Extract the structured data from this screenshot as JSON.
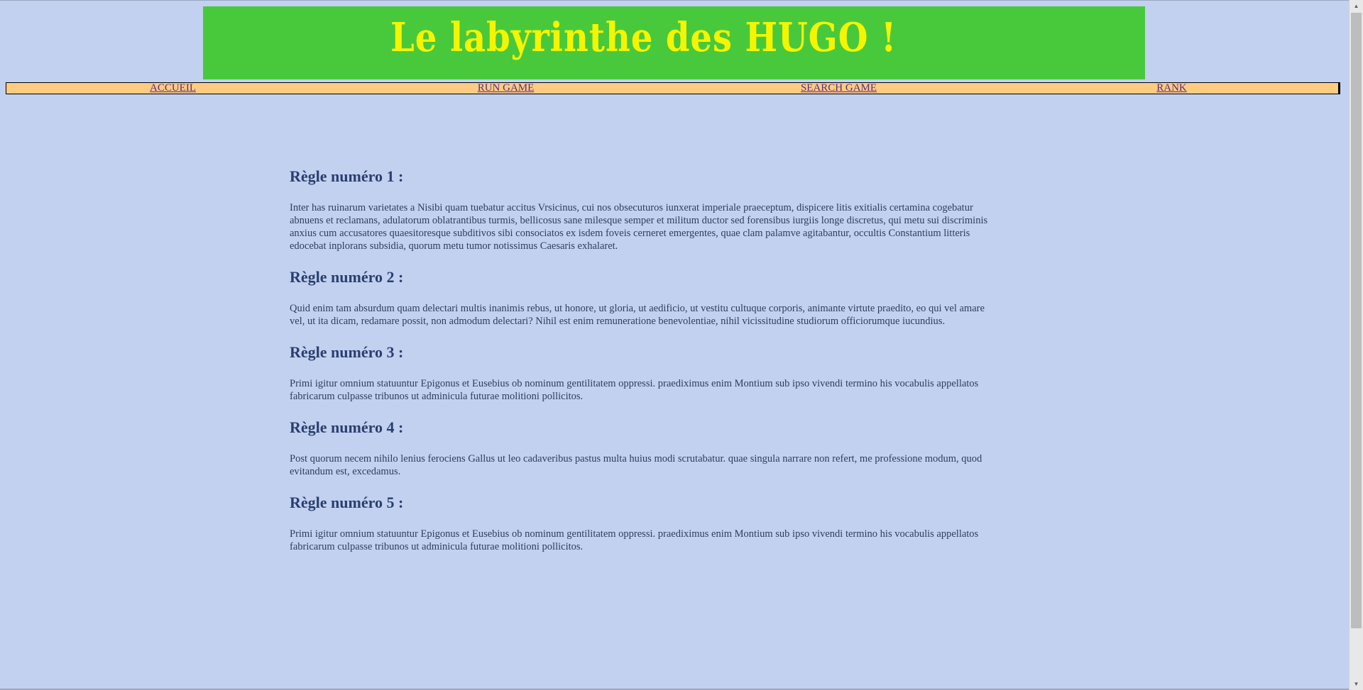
{
  "header": {
    "title": "Le labyrinthe des HUGO !"
  },
  "nav": {
    "items": [
      {
        "label": "ACCUEIL"
      },
      {
        "label": "RUN GAME"
      },
      {
        "label": "SEARCH GAME"
      },
      {
        "label": "RANK"
      }
    ]
  },
  "rules": [
    {
      "title": "Règle numéro 1 :",
      "text": "Inter has ruinarum varietates a Nisibi quam tuebatur accitus Vrsicinus, cui nos obsecuturos iunxerat imperiale praeceptum, dispicere litis exitialis certamina cogebatur abnuens et reclamans, adulatorum oblatrantibus turmis, bellicosus sane milesque semper et militum ductor sed forensibus iurgiis longe discretus, qui metu sui discriminis anxius cum accusatores quaesitoresque subditivos sibi consociatos ex isdem foveis cerneret emergentes, quae clam palamve agitabantur, occultis Constantium litteris edocebat inplorans subsidia, quorum metu tumor notissimus Caesaris exhalaret."
    },
    {
      "title": "Règle numéro 2 :",
      "text": "Quid enim tam absurdum quam delectari multis inanimis rebus, ut honore, ut gloria, ut aedificio, ut vestitu cultuque corporis, animante virtute praedito, eo qui vel amare vel, ut ita dicam, redamare possit, non admodum delectari? Nihil est enim remuneratione benevolentiae, nihil vicissitudine studiorum officiorumque iucundius."
    },
    {
      "title": "Règle numéro 3 :",
      "text": "Primi igitur omnium statuuntur Epigonus et Eusebius ob nominum gentilitatem oppressi. praediximus enim Montium sub ipso vivendi termino his vocabulis appellatos fabricarum culpasse tribunos ut adminicula futurae molitioni pollicitos."
    },
    {
      "title": "Règle numéro 4 :",
      "text": "Post quorum necem nihilo lenius ferociens Gallus ut leo cadaveribus pastus multa huius modi scrutabatur. quae singula narrare non refert, me professione modum, quod evitandum est, excedamus."
    },
    {
      "title": "Règle numéro 5 :",
      "text": "Primi igitur omnium statuuntur Epigonus et Eusebius ob nominum gentilitatem oppressi. praediximus enim Montium sub ipso vivendi termino his vocabulis appellatos fabricarum culpasse tribunos ut adminicula futurae molitioni pollicitos."
    }
  ],
  "colors": {
    "background": "#c2d1f0",
    "banner": "#48c93c",
    "banner_text": "#f5f500",
    "navbar": "#fecb80",
    "link": "#5a2d82",
    "heading": "#2a3f6e"
  }
}
